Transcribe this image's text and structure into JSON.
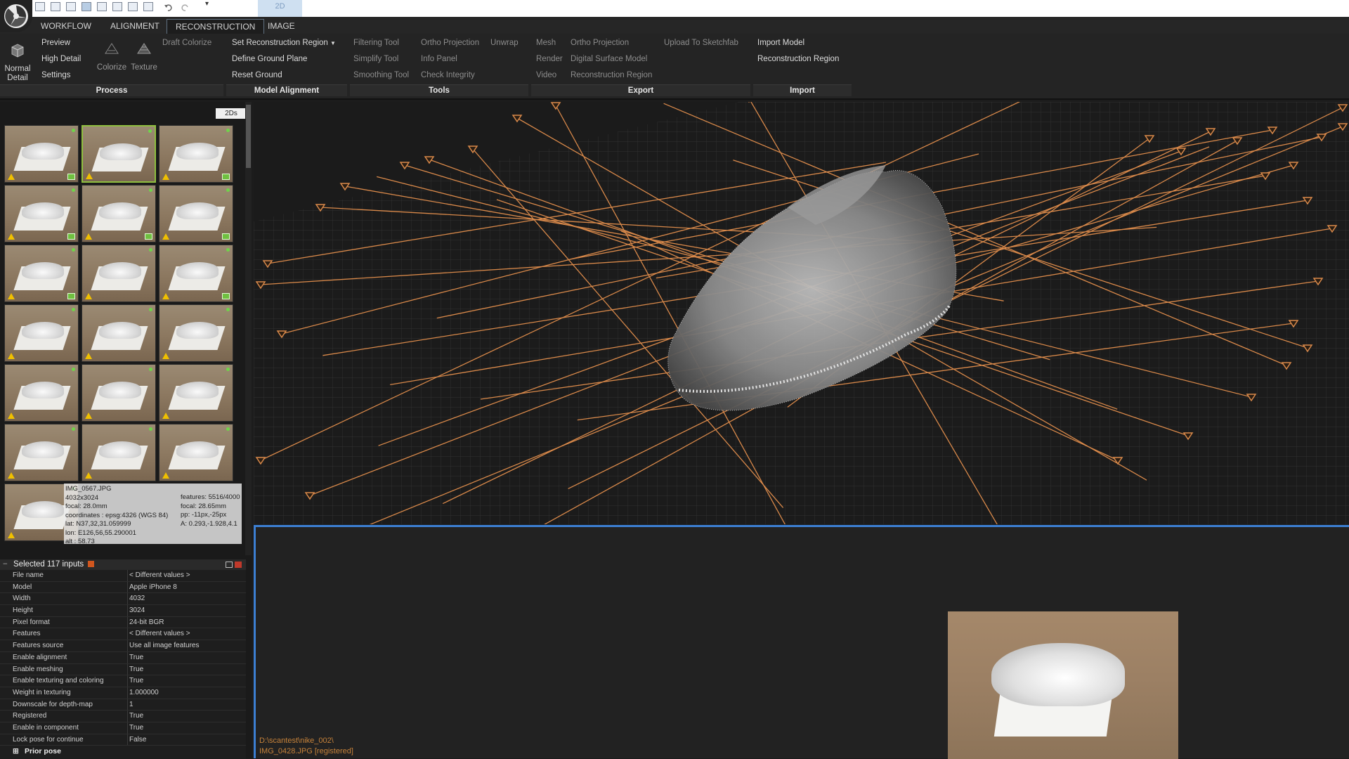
{
  "app": {
    "quick_access_dropdown": "▾",
    "layout_label": "2D"
  },
  "menu_tabs": [
    {
      "label": "WORKFLOW"
    },
    {
      "label": "ALIGNMENT"
    },
    {
      "label": "RECONSTRUCTION"
    },
    {
      "label": "IMAGE"
    }
  ],
  "ribbon": {
    "process": {
      "normal_detail": "Normal Detail",
      "preview": "Preview",
      "high_detail": "High Detail",
      "settings": "Settings",
      "colorize": "Colorize",
      "texture": "Texture",
      "draft_colorize": "Draft Colorize",
      "group": "Process"
    },
    "model_alignment": {
      "set_region": "Set Reconstruction Region",
      "define_ground": "Define Ground Plane",
      "reset_ground": "Reset Ground",
      "group": "Model Alignment"
    },
    "tools": {
      "filtering": "Filtering Tool",
      "simplify": "Simplify Tool",
      "smoothing": "Smoothing Tool",
      "ortho": "Ortho Projection",
      "unwrap": "Unwrap",
      "info": "Info Panel",
      "integrity": "Check Integrity",
      "group": "Tools"
    },
    "export": {
      "mesh": "Mesh",
      "render": "Render",
      "video": "Video",
      "ortho": "Ortho Projection",
      "dsm": "Digital Surface Model",
      "region": "Reconstruction Region",
      "sketchfab": "Upload To Sketchfab",
      "group": "Export"
    },
    "import": {
      "model": "Import Model",
      "region": "Reconstruction Region",
      "group": "Import"
    }
  },
  "images_panel": {
    "badge": "2Ds",
    "tooltip": {
      "name": "IMG_0567.JPG",
      "size": "4032x3024",
      "focal": "focal: 28.0mm",
      "coordinates": "coordinates : epsg:4326 (WGS 84)",
      "lat": "lat: N37,32,31.059999",
      "lon": "lon: E126,56,55.290001",
      "alt": "alt : 58.73",
      "features": "features: 5516/4000",
      "focal2": "focal: 28.65mm",
      "pp": "pp: -11px,-25px",
      "a": "A: 0.293,-1.928,4.1"
    }
  },
  "selected": {
    "title": "Selected 117 inputs",
    "rows": [
      {
        "k": "File name",
        "v": "< Different values >"
      },
      {
        "k": "Model",
        "v": "Apple iPhone 8"
      },
      {
        "k": "Width",
        "v": "4032"
      },
      {
        "k": "Height",
        "v": "3024"
      },
      {
        "k": "Pixel format",
        "v": "24-bit BGR"
      },
      {
        "k": "Features",
        "v": "< Different values >"
      },
      {
        "k": "Features source",
        "v": "Use all image features"
      },
      {
        "k": "Enable alignment",
        "v": "True"
      },
      {
        "k": "Enable meshing",
        "v": "True"
      },
      {
        "k": "Enable texturing and coloring",
        "v": "True"
      },
      {
        "k": "Weight in texturing",
        "v": "1.000000"
      },
      {
        "k": "Downscale for depth-map",
        "v": "1"
      },
      {
        "k": "Registered",
        "v": "True"
      },
      {
        "k": "Enable in component",
        "v": "True"
      },
      {
        "k": "Lock pose for continue",
        "v": "False"
      }
    ],
    "prior_pose": "Prior pose"
  },
  "view2d": {
    "path": "D:\\scantest\\nike_002\\",
    "file": "IMG_0428.JPG [registered]"
  },
  "colors": {
    "accent": "#3c7fd2",
    "camera": "#d9894a",
    "warning": "#f0c000",
    "ok": "#6fbf40"
  }
}
